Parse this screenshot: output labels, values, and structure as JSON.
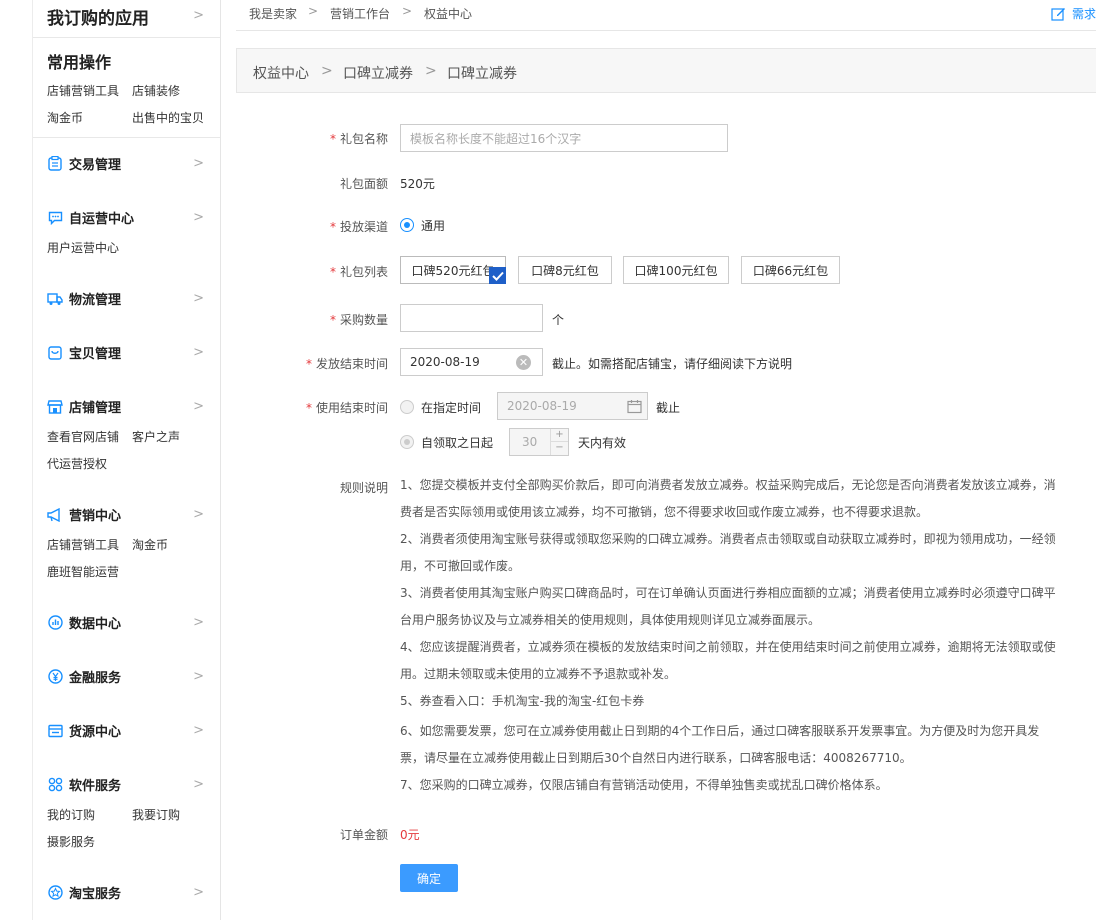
{
  "sidebar": {
    "ordered_apps": "我订购的应用",
    "common_title": "常用操作",
    "common_links": [
      "店铺营销工具",
      "店铺装修",
      "淘金币",
      "出售中的宝贝"
    ],
    "sections": [
      {
        "label": "交易管理",
        "icon": "clipboard-icon",
        "links": []
      },
      {
        "label": "自运营中心",
        "icon": "chat-icon",
        "links": [
          "用户运营中心"
        ]
      },
      {
        "label": "物流管理",
        "icon": "truck-icon",
        "links": []
      },
      {
        "label": "宝贝管理",
        "icon": "bag-icon",
        "links": []
      },
      {
        "label": "店铺管理",
        "icon": "store-icon",
        "links": [
          "查看官网店铺",
          "客户之声",
          "代运营授权"
        ]
      },
      {
        "label": "营销中心",
        "icon": "megaphone-icon",
        "links": [
          "店铺营销工具",
          "淘金币",
          "鹿班智能运营"
        ]
      },
      {
        "label": "数据中心",
        "icon": "chart-icon",
        "links": []
      },
      {
        "label": "金融服务",
        "icon": "yuan-icon",
        "links": []
      },
      {
        "label": "货源中心",
        "icon": "box-icon",
        "links": []
      },
      {
        "label": "软件服务",
        "icon": "grid-icon",
        "links": [
          "我的订购",
          "我要订购",
          "摄影服务"
        ]
      },
      {
        "label": "淘宝服务",
        "icon": "star-icon",
        "links": []
      }
    ]
  },
  "top_breadcrumb": {
    "items": [
      "我是卖家",
      "营销工作台",
      "权益中心"
    ],
    "sep": ">",
    "right_link": "需求"
  },
  "page_breadcrumb": {
    "items": [
      "权益中心",
      "口碑立减券",
      "口碑立减券"
    ],
    "sep": ">"
  },
  "form": {
    "name_label": "礼包名称",
    "name_placeholder": "模板名称长度不能超过16个汉字",
    "face_label": "礼包面额",
    "face_value": "520元",
    "channel_label": "投放渠道",
    "channel_option": "通用",
    "list_label": "礼包列表",
    "gifts": [
      "口碑520元红包",
      "口碑8元红包",
      "口碑100元红包",
      "口碑66元红包"
    ],
    "qty_label": "采购数量",
    "qty_unit": "个",
    "issue_end_label": "发放结束时间",
    "issue_end_value": "2020-08-19",
    "issue_end_note": "截止。如需搭配店铺宝，请仔细阅读下方说明",
    "use_end_label": "使用结束时间",
    "use_opt1": "在指定时间",
    "use_date": "2020-08-19",
    "use_opt1_suffix": "截止",
    "use_opt2": "自领取之日起",
    "use_days": "30",
    "use_opt2_suffix": "天内有效",
    "rules_label": "规则说明",
    "rules": [
      "1、您提交模板并支付全部购买价款后，即可向消费者发放立减券。权益采购完成后，无论您是否向消费者发放该立减券，消费者是否实际领用或使用该立减券，均不可撤销，您不得要求收回或作废立减券，也不得要求退款。",
      "2、消费者须使用淘宝账号获得或领取您采购的口碑立减券。消费者点击领取或自动获取立减券时，即视为领用成功，一经领用，不可撤回或作废。",
      "3、消费者使用其淘宝账户购买口碑商品时，可在订单确认页面进行券相应面额的立减；消费者使用立减券时必须遵守口碑平台用户服务协议及与立减券相关的使用规则，具体使用规则详见立减券面展示。",
      "4、您应该提醒消费者，立减券须在模板的发放结束时间之前领取，并在使用结束时间之前使用立减券，逾期将无法领取或使用。过期未领取或未使用的立减券不予退款或补发。",
      "5、券查看入口：手机淘宝-我的淘宝-红包卡券",
      "6、如您需要发票，您可在立减券使用截止日到期的4个工作日后，通过口碑客服联系开发票事宜。为方便及时为您开具发票，请尽量在立减券使用截止日到期后30个自然日内进行联系，口碑客服电话：4008267710。",
      "7、您采购的口碑立减券，仅限店铺自有营销活动使用，不得单独售卖或扰乱口碑价格体系。"
    ],
    "amount_label": "订单金额",
    "amount_value": "0元",
    "confirm": "确定"
  },
  "colors": {
    "accent": "#1890ff",
    "required": "#e4393c",
    "price": "#e4393c"
  }
}
